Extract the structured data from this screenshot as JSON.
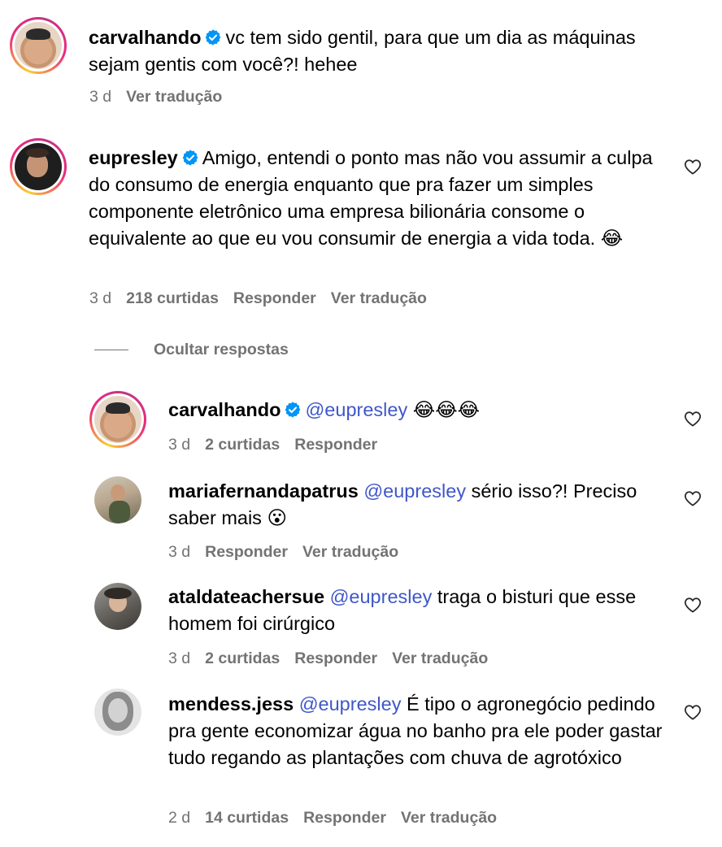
{
  "comments": [
    {
      "username": "carvalhando",
      "text": "vc tem sido gentil, para que um dia as máquinas sejam gentis com você?! hehee",
      "time": "3 d",
      "actions": [
        "Ver tradução"
      ]
    },
    {
      "username": "eupresley",
      "text": "Amigo, entendi o ponto mas não vou assumir a culpa do consumo de energia enquanto que pra fazer um simples componente eletrônico uma empresa bilionária consome o equivalente ao que eu vou consumir de energia a vida toda.",
      "emoji": "😂",
      "time": "3 d",
      "likes": "218 curtidas",
      "actions": [
        "Responder",
        "Ver tradução"
      ]
    }
  ],
  "hide_replies": "Ocultar respostas",
  "replies": [
    {
      "username": "carvalhando",
      "mention": "@eupresley",
      "text": "",
      "emoji": "😂😂😂",
      "time": "3 d",
      "likes": "2 curtidas",
      "actions": [
        "Responder"
      ]
    },
    {
      "username": "mariafernandapatrus",
      "mention": "@eupresley",
      "text": "sério isso?! Preciso saber mais",
      "emoji": "😮",
      "time": "3 d",
      "actions": [
        "Responder",
        "Ver tradução"
      ]
    },
    {
      "username": "ataldateachersue",
      "mention": "@eupresley",
      "text": "traga o bisturi que esse homem foi cirúrgico",
      "time": "3 d",
      "likes": "2 curtidas",
      "actions": [
        "Responder",
        "Ver tradução"
      ]
    },
    {
      "username": "mendess.jess",
      "mention": "@eupresley",
      "text": "É tipo o agronegócio pedindo pra gente economizar água no banho pra ele poder gastar tudo regando as plantações com chuva de agrotóxico",
      "time": "2 d",
      "likes": "14 curtidas",
      "actions": [
        "Responder",
        "Ver tradução"
      ]
    }
  ],
  "icons": {
    "verified": "verified-badge-icon",
    "like": "heart-outline-icon"
  },
  "colors": {
    "mention": "#3f57c9",
    "meta": "#737373",
    "verified": "#0095f6"
  }
}
